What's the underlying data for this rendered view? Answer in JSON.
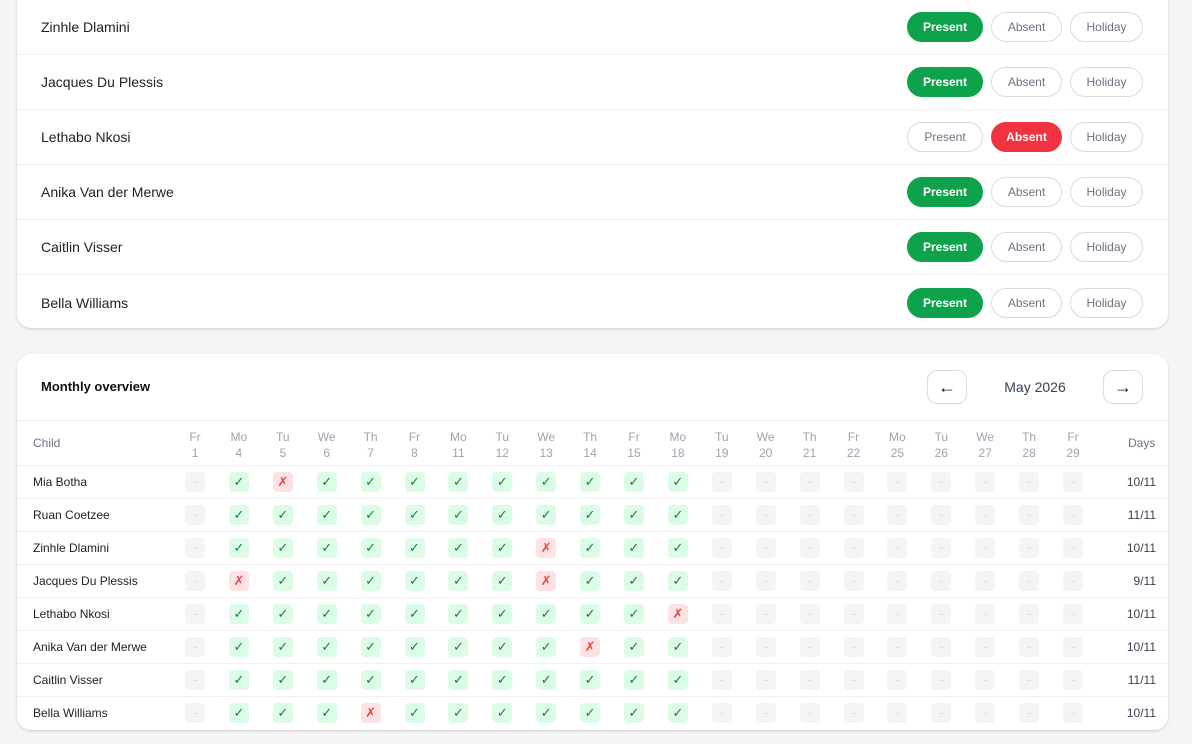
{
  "daily": {
    "rows": [
      {
        "name": "Zinhle Dlamini",
        "status": "present"
      },
      {
        "name": "Jacques Du Plessis",
        "status": "present"
      },
      {
        "name": "Lethabo Nkosi",
        "status": "absent"
      },
      {
        "name": "Anika Van der Merwe",
        "status": "present"
      },
      {
        "name": "Caitlin Visser",
        "status": "present"
      },
      {
        "name": "Bella Williams",
        "status": "present"
      }
    ],
    "labels": {
      "present": "Present",
      "absent": "Absent",
      "holiday": "Holiday"
    }
  },
  "monthly": {
    "title": "Monthly overview",
    "month": "May 2026",
    "prev_label": "←",
    "next_label": "→",
    "child_header": "Child",
    "days_header": "Days",
    "days": [
      {
        "dow": "Fr",
        "num": "1"
      },
      {
        "dow": "Mo",
        "num": "4"
      },
      {
        "dow": "Tu",
        "num": "5"
      },
      {
        "dow": "We",
        "num": "6"
      },
      {
        "dow": "Th",
        "num": "7"
      },
      {
        "dow": "Fr",
        "num": "8"
      },
      {
        "dow": "Mo",
        "num": "11"
      },
      {
        "dow": "Tu",
        "num": "12"
      },
      {
        "dow": "We",
        "num": "13"
      },
      {
        "dow": "Th",
        "num": "14"
      },
      {
        "dow": "Fr",
        "num": "15"
      },
      {
        "dow": "Mo",
        "num": "18"
      },
      {
        "dow": "Tu",
        "num": "19"
      },
      {
        "dow": "We",
        "num": "20"
      },
      {
        "dow": "Th",
        "num": "21"
      },
      {
        "dow": "Fr",
        "num": "22"
      },
      {
        "dow": "Mo",
        "num": "25"
      },
      {
        "dow": "Tu",
        "num": "26"
      },
      {
        "dow": "We",
        "num": "27"
      },
      {
        "dow": "Th",
        "num": "28"
      },
      {
        "dow": "Fr",
        "num": "29"
      }
    ],
    "symbols": {
      "P": "✓",
      "A": "✗",
      "N": "–"
    },
    "rows": [
      {
        "name": "Mia Botha",
        "marks": "NPAPPPPPPPPPNNNNNNNNN",
        "days": "10/11"
      },
      {
        "name": "Ruan Coetzee",
        "marks": "NPPPPPPPPPPPNNNNNNNNN",
        "days": "11/11"
      },
      {
        "name": "Zinhle Dlamini",
        "marks": "NPPPPPPPAPPPNNNNNNNNN",
        "days": "10/11"
      },
      {
        "name": "Jacques Du Plessis",
        "marks": "NAPPPPPPAPPPNNNNNNNNN",
        "days": "9/11"
      },
      {
        "name": "Lethabo Nkosi",
        "marks": "NPPPPPPPPPPANNNNNNNNN",
        "days": "10/11"
      },
      {
        "name": "Anika Van der Merwe",
        "marks": "NPPPPPPPPAPPNNNNNNNNN",
        "days": "10/11"
      },
      {
        "name": "Caitlin Visser",
        "marks": "NPPPPPPPPPPPNNNNNNNNN",
        "days": "11/11"
      },
      {
        "name": "Bella Williams",
        "marks": "NPPPAPPPPPPPNNNNNNNNN",
        "days": "10/11"
      }
    ]
  }
}
